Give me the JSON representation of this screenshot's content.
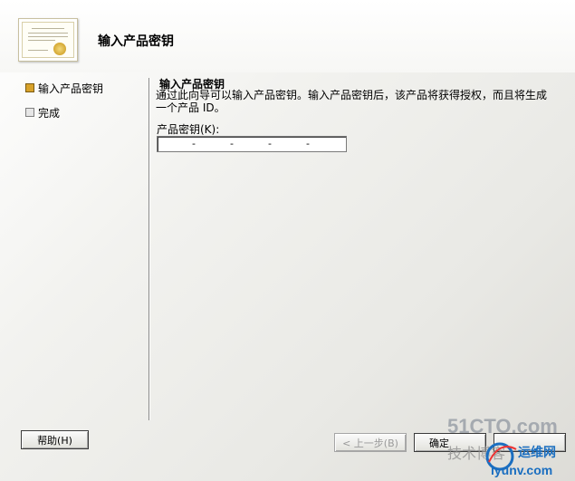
{
  "header": {
    "title": "输入产品密钥",
    "icon": "certificate-icon"
  },
  "steps": [
    {
      "label": "输入产品密钥",
      "active": true
    },
    {
      "label": "完成",
      "active": false
    }
  ],
  "content": {
    "title": "输入产品密钥",
    "description": "通过此向导可以输入产品密钥。输入产品密钥后，该产品将获得授权，而且将生成一个产品 ID。",
    "field_label": "产品密钥(K):",
    "key_value": "",
    "key_separator": "-"
  },
  "buttons": {
    "help": "帮助(H)",
    "back": "< 上一步(B)",
    "ok": "确定",
    "other": ""
  },
  "watermark": {
    "brand": "51CTO.com",
    "sub1": "技术博客",
    "sub2": "运维网",
    "url": "iyunv.com"
  },
  "colors": {
    "accent_step": "#d8a22a",
    "watermark_blue": "#1a6ec0"
  }
}
